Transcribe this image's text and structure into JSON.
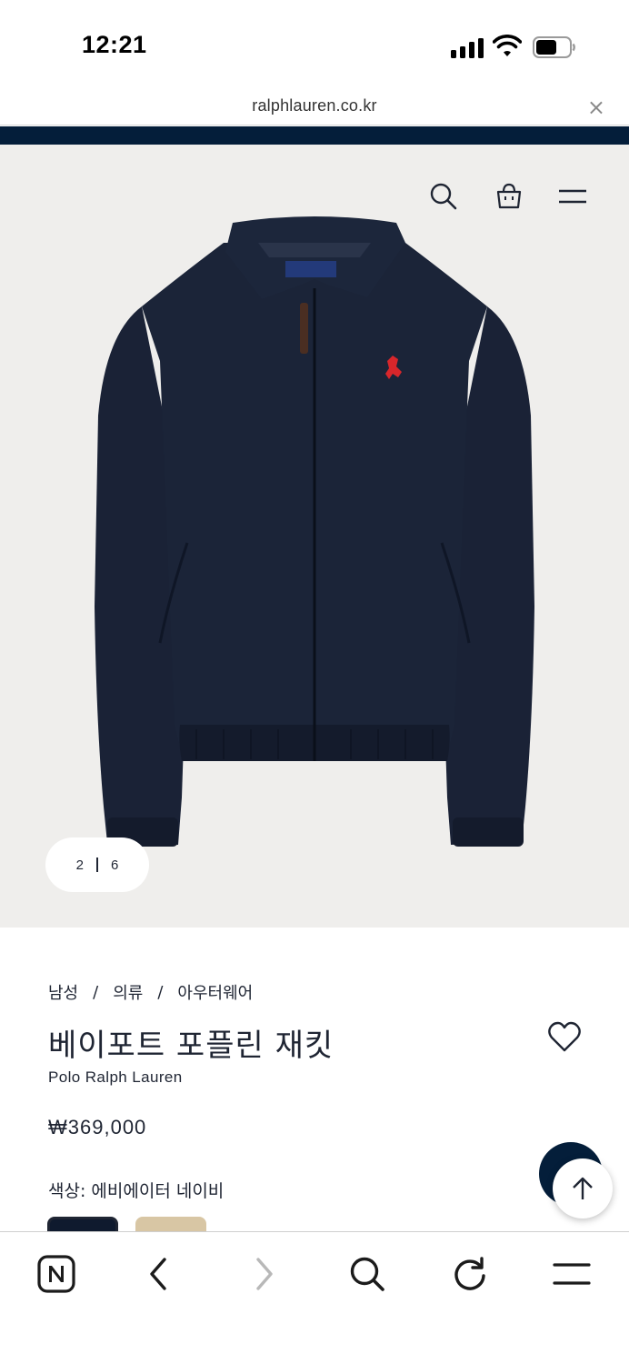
{
  "status_bar": {
    "time": "12:21"
  },
  "url_bar": {
    "url": "ralphlauren.co.kr",
    "close_glyph": "×"
  },
  "header": {
    "icons": [
      "search-icon",
      "shopping-bag-icon",
      "menu-icon"
    ]
  },
  "gallery": {
    "current": "2",
    "total": "6"
  },
  "product": {
    "breadcrumb": [
      "남성",
      "의류",
      "아우터웨어"
    ],
    "breadcrumb_separator": "/",
    "title": "베이포트 포플린 재킷",
    "brand": "Polo Ralph Lauren",
    "price": "₩369,000",
    "color_label": "색상: 에비에이터 네이비",
    "swatches": [
      {
        "name": "navy",
        "color": "#0f1a2e",
        "selected": true
      },
      {
        "name": "tan",
        "color": "#d8c6a4",
        "selected": false
      }
    ]
  },
  "floating": {
    "scroll_top_icon": "arrow-up-icon"
  },
  "bottom_bar": {
    "icons": [
      "naver-home-icon",
      "back-icon",
      "forward-icon",
      "search-icon",
      "refresh-icon",
      "menu-icon"
    ]
  },
  "colors": {
    "navy": "#041e3a",
    "text": "#1f2533",
    "hero_bg": "#efeeec"
  }
}
